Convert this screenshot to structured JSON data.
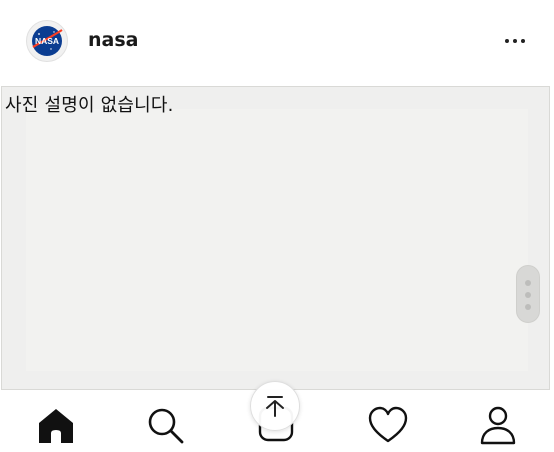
{
  "post": {
    "username": "nasa",
    "photo_alt_text": "사진 설명이 없습니다."
  },
  "icons": {
    "avatar": "nasa-logo-icon",
    "more": "more-options-icon",
    "home": "home-icon",
    "search": "search-icon",
    "scroll_top": "scroll-to-top-icon",
    "activity": "heart-icon",
    "profile": "profile-icon"
  },
  "colors": {
    "nasa_blue": "#0b3d91",
    "nasa_red": "#fc3d21",
    "photo_background": "#efefee"
  }
}
